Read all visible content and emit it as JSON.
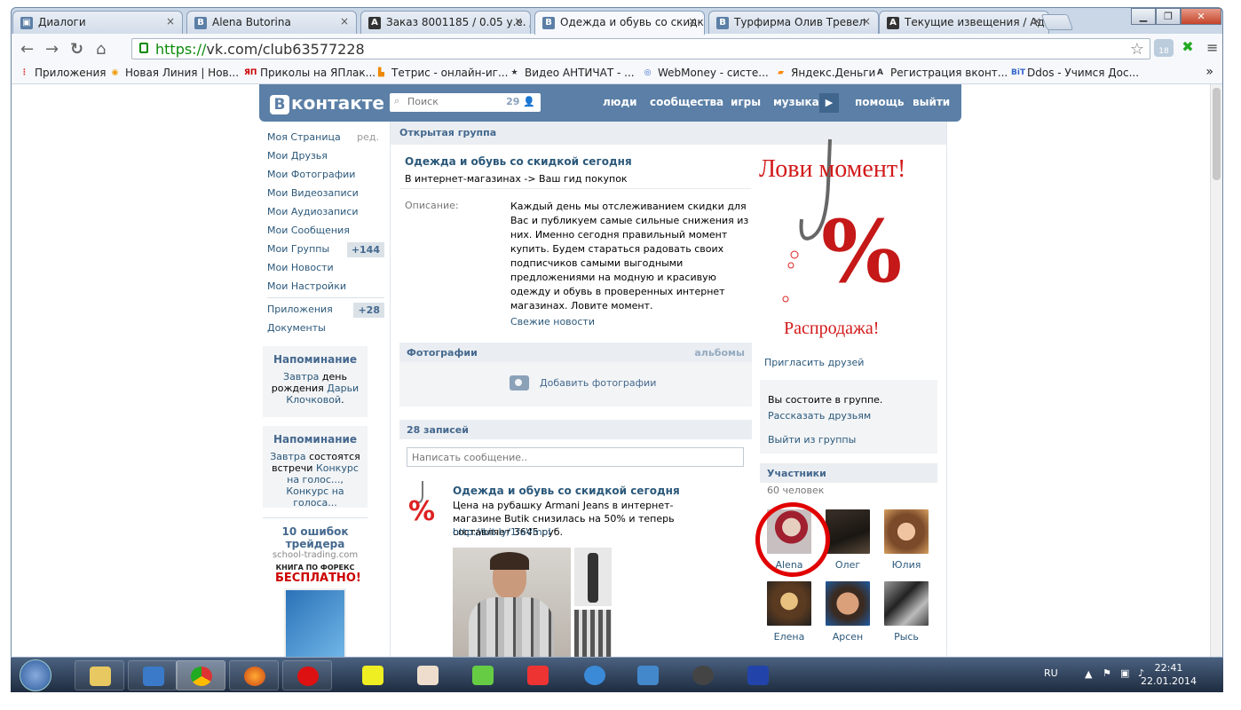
{
  "browser": {
    "tabs": [
      {
        "title": "Диалоги",
        "icon": "vk-icon",
        "color": "#5b7fa6",
        "glyph": "▣"
      },
      {
        "title": "Alena Butorina",
        "icon": "vk-icon",
        "color": "#5b7fa6",
        "glyph": "B"
      },
      {
        "title": "Заказ 8001185 / 0.05 у.е. /",
        "icon": "a-icon",
        "color": "#333",
        "glyph": "A"
      },
      {
        "title": "Одежда и обувь со скидк",
        "icon": "vk-icon",
        "color": "#5b7fa6",
        "glyph": "B"
      },
      {
        "title": "Турфирма Олив Тревел",
        "icon": "vk-icon",
        "color": "#5b7fa6",
        "glyph": "B"
      },
      {
        "title": "Текущие извещения / Ад",
        "icon": "a-icon",
        "color": "#333",
        "glyph": "A"
      }
    ],
    "url_scheme": "https://",
    "url_rest": "vk.com/club63577228",
    "bookmarks": [
      {
        "label": "Приложения",
        "color": "#d33",
        "glyph": "⋮"
      },
      {
        "label": "Новая Линия | Нов...",
        "color": "#e90",
        "glyph": "◉"
      },
      {
        "label": "Приколы на ЯПлак...",
        "color": "#c00",
        "glyph": "ЯП"
      },
      {
        "label": "Тетрис - онлайн-иг...",
        "color": "#e80",
        "glyph": "▙"
      },
      {
        "label": "Видео АНТИЧАТ - ...",
        "color": "#333",
        "glyph": "★"
      },
      {
        "label": "WebMoney - систе...",
        "color": "#36c",
        "glyph": "◎"
      },
      {
        "label": "Яндекс.Деньги",
        "color": "#f80",
        "glyph": "▰"
      },
      {
        "label": "Регистрация вконт...",
        "color": "#333",
        "glyph": "A"
      },
      {
        "label": "Ddos - Учимся Дос...",
        "color": "#36c",
        "glyph": "BiT"
      }
    ],
    "more": "»"
  },
  "vk": {
    "logo": "контакте",
    "logo_b": "В",
    "search_placeholder": "Поиск",
    "search_count": "29",
    "menu": [
      "люди",
      "сообщества",
      "игры",
      "музыка",
      "помощь",
      "выйти"
    ]
  },
  "leftnav": {
    "items": [
      "Моя Страница",
      "Мои Друзья",
      "Мои Фотографии",
      "Мои Видеозаписи",
      "Мои Аудиозаписи",
      "Мои Сообщения",
      "Мои Группы",
      "Мои Новости",
      "Мои Настройки"
    ],
    "edit": "ред.",
    "groups_badge": "+144",
    "apps": "Приложения",
    "apps_badge": "+28",
    "docs": "Документы"
  },
  "reminders": [
    {
      "title": "Напоминание",
      "a": "Завтра",
      "b": " день рождения ",
      "c": "Дарьи Клочковой",
      "d": "."
    },
    {
      "title": "Напоминание",
      "a": "Завтра",
      "b": " состоятся встречи ",
      "c": "Конкурс на голос..., Конкурс на голоса...",
      "d": ""
    }
  ],
  "ad": {
    "title": "10 ошибок трейдера",
    "site": "school-trading.com",
    "img_text1": "КНИГА ПО ФОРЕКС",
    "img_text2": "БЕСПЛАТНО!"
  },
  "group": {
    "open_label": "Открытая группа",
    "name": "Одежда и обувь со скидкой сегодня",
    "status": "В интернет-магазинах -> Ваш гид покупок",
    "desc_label": "Описание:",
    "desc": "Каждый день мы отслеживанием скидки для Вас и публикуем самые сильные снижения из них. Именно сегодня правильный момент купить. Будем стараться радовать своих подписчиков самыми выгодными предложениями на модную и красивую одежду и обувь в проверенных интернет магазинах. Ловите момент.",
    "fresh": "Свежие новости",
    "photos": "Фотографии",
    "albums": "альбомы",
    "add_photos": "Добавить фотографии",
    "posts_count": "28 записей",
    "wall_placeholder": "Написать сообщение.."
  },
  "post": {
    "author": "Одежда и обувь со скидкой сегодня",
    "text": "Цена на рубашку Armani Jeans в интернет-магазине Butik снизилась на 50% и теперь составляет 3645 руб.",
    "link": "http://bit.ly/1faVmoI"
  },
  "promo": {
    "line1": "Лови момент!",
    "line2": "Распродажа!",
    "pct": "%"
  },
  "side": {
    "invite": "Пригласить друзей",
    "member_status": "Вы состоите в группе.",
    "tell": "Рассказать друзьям",
    "leave": "Выйти из группы",
    "participants": "Участники",
    "count": "60 человек",
    "members": [
      "Alena",
      "Олег",
      "Юлия",
      "Елена",
      "Арсен",
      "Рысь"
    ]
  },
  "tray": {
    "lang": "RU",
    "time": "22:41",
    "date": "22.01.2014"
  }
}
